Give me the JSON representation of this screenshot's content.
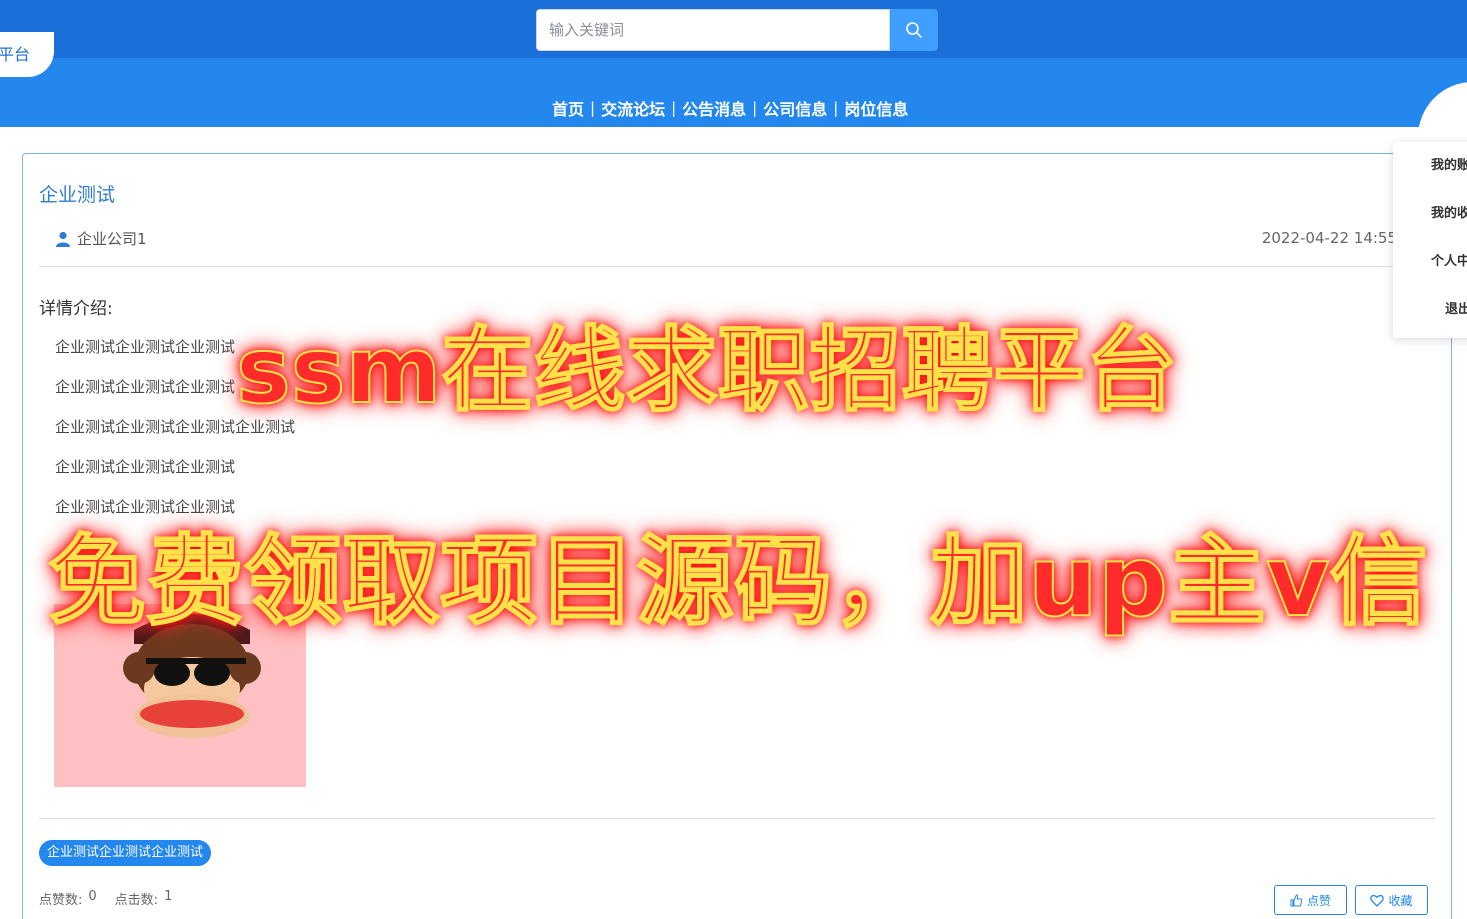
{
  "header": {
    "logo_text": "平台",
    "search": {
      "placeholder": "输入关键词",
      "icon": "search-icon"
    },
    "nav": [
      "首页",
      "交流论坛",
      "公告消息",
      "公司信息",
      "岗位信息"
    ],
    "user_menu": [
      "我的账",
      "我的收",
      "个人中",
      "退出"
    ]
  },
  "post": {
    "title": "企业测试",
    "author": "企业公司1",
    "author_icon": "user-icon",
    "date": "2022-04-22 14:55",
    "detail_label": "详情介绍:",
    "paragraphs": [
      "企业测试企业测试企业测试",
      "企业测试企业测试企业测试",
      "企业测试企业测试企业测试企业测试",
      "企业测试企业测试企业测试",
      "企业测试企业测试企业测试"
    ],
    "tag": "企业测试企业测试企业测试",
    "likes_label": "点赞数:",
    "likes": "0",
    "clicks_label": "点击数:",
    "clicks": "1",
    "like_button": "点赞",
    "favorite_button": "收藏"
  },
  "overlay": {
    "line1": "ssm在线求职招聘平台",
    "line2": "免费领取项目源码，加up主v信"
  },
  "colors": {
    "topbar": "#1b6fd8",
    "nav_band": "#2387ee",
    "accent": "#409eff",
    "overlay_text": "#ff2b2b",
    "overlay_stroke": "#ffe14a"
  }
}
